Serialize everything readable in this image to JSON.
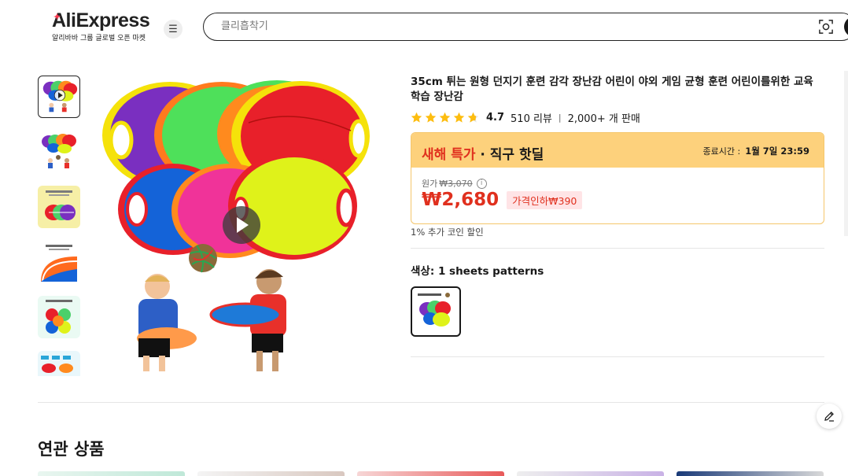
{
  "header": {
    "logo_text": "AliExpress",
    "logo_subtitle": "알리바바 그룹 글로벌 오픈 마켓",
    "menu_icon": "hamburger-icon",
    "search_placeholder": "클리흡착기",
    "camera_icon": "camera-search-icon"
  },
  "product": {
    "title": "35cm 튀는 원형 던지기 훈련 감각 장난감 어린이 야외 게임 균형 훈련 어린이를위한 교육 학습 장난감",
    "rating": "4.7",
    "reviews": "510 리뷰",
    "sold": "2,000+ 개 판매",
    "star_count": 4.7
  },
  "deal": {
    "title_highlight": "새해 특가",
    "title_rest": " · 직구 핫딜",
    "end_label": "종료시간 :",
    "end_time": "1월 7일 23:59",
    "original_label": "원가",
    "original_price": "₩3,070",
    "info_icon": "i",
    "price": "₩2,680",
    "discount": "가격인하₩390",
    "coin_note": "1% 추가 코인 할인"
  },
  "options": {
    "color_label": "색상: 1 sheets patterns"
  },
  "related": {
    "title": "연관 상품"
  },
  "colors": {
    "price_red": "#e0301e",
    "deal_bg": "#fdd17c",
    "discount_bg": "#ffe4e6",
    "star": "#fdbd10"
  }
}
